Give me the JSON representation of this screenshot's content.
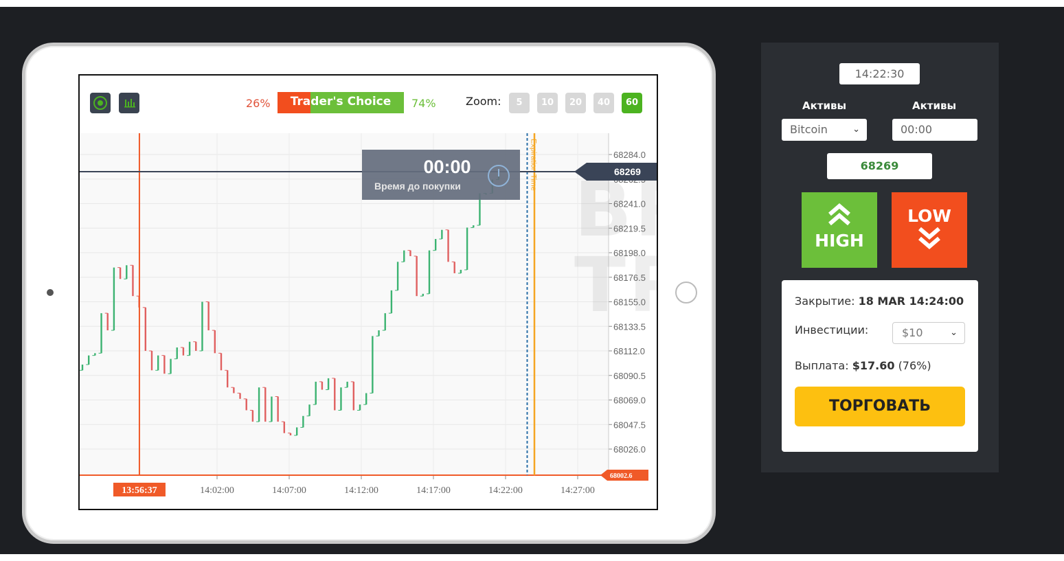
{
  "chart_toolbar": {
    "icons": [
      "target-icon",
      "bar-chart-icon"
    ],
    "traders_choice_label": "Trader's Choice",
    "pct_low": "26%",
    "pct_high": "74%",
    "low_fraction": 0.26,
    "zoom_label": "Zoom:",
    "zoom_options": [
      "5",
      "10",
      "20",
      "40",
      "60"
    ],
    "zoom_active": "60"
  },
  "chart_data": {
    "type": "candlestick",
    "y_ticks": [
      "68284.0",
      "68262.5",
      "68241.0",
      "68219.5",
      "68198.0",
      "68176.5",
      "68155.0",
      "68133.5",
      "68112.0",
      "68090.5",
      "68069.0",
      "68047.5",
      "68026.0"
    ],
    "ylim": [
      68002.6,
      68300
    ],
    "x_ticks": [
      "14:02:00",
      "14:07:00",
      "14:12:00",
      "14:17:00",
      "14:22:00",
      "14:27:00"
    ],
    "current_price": "68269",
    "low_marker": "68002.6",
    "start_marker": "13:56:37",
    "expiration_label": "Expiration Time",
    "countdown": "00:00",
    "countdown_label": "Время до покупки",
    "closes": [
      68100,
      68108,
      68110,
      68145,
      68130,
      68185,
      68175,
      68187,
      68160,
      68150,
      68112,
      68095,
      68108,
      68092,
      68105,
      68115,
      68108,
      68120,
      68112,
      68155,
      68130,
      68110,
      68095,
      68080,
      68075,
      68070,
      68060,
      68050,
      68080,
      68050,
      68072,
      68050,
      68040,
      68038,
      68045,
      68055,
      68065,
      68085,
      68078,
      68088,
      68060,
      68080,
      68085,
      68060,
      68065,
      68075,
      68125,
      68130,
      68145,
      68165,
      68190,
      68200,
      68195,
      68160,
      68162,
      68200,
      68210,
      68218,
      68190,
      68180,
      68183,
      68220,
      68222,
      68250,
      68250,
      68262,
      68269
    ],
    "colors": {
      "up": "#3cb371",
      "down": "#e06060",
      "price_line": "#3a4457",
      "start_line": "#f05a28",
      "expiry_line": "#f5a623",
      "purchase_line": "#2a6fa8"
    }
  },
  "watermark": "BROKER TRIBUNAL",
  "panel": {
    "time": "14:22:30",
    "asset_label": "Активы",
    "asset_value": "Bitcoin",
    "time_label": "Активы",
    "time_value": "00:00",
    "price": "68269",
    "high_label": "HIGH",
    "low_label": "LOW",
    "close_label": "Закрытие:",
    "close_value": "18 MAR 14:24:00",
    "investment_label": "Инвестиции:",
    "investment_value": "$10",
    "payout_label": "Выплата:",
    "payout_value": "$17.60",
    "payout_pct": "(76%)",
    "trade_button": "ТОРГОВАТЬ"
  },
  "colors": {
    "high": "#6cbf3a",
    "low": "#f24e1e",
    "trade": "#fdc010",
    "panel_bg": "#2b2e33"
  }
}
